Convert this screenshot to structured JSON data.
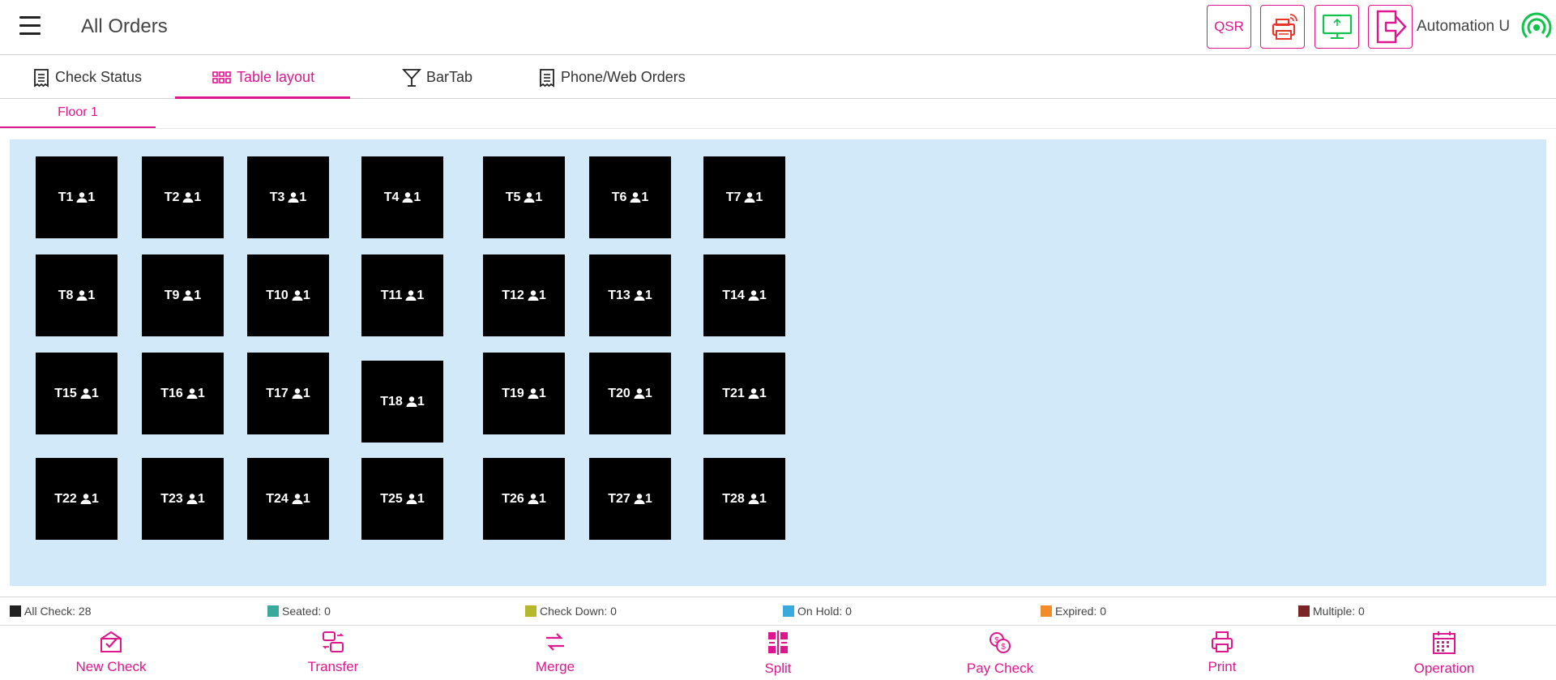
{
  "header": {
    "title": "All Orders",
    "qsr_label": "QSR",
    "user_name": "Automation U",
    "menu_icon": "hamburger-icon",
    "printer_icon": "wireless-printer-icon",
    "monitor_icon": "monitor-sync-icon",
    "logout_icon": "logout-icon",
    "signal_icon": "online-signal-icon"
  },
  "tabs": [
    {
      "label": "Check Status",
      "icon": "receipt-icon"
    },
    {
      "label": "Table layout",
      "icon": "grid-icon",
      "active": true
    },
    {
      "label": "BarTab",
      "icon": "cocktail-icon"
    },
    {
      "label": "Phone/Web Orders",
      "icon": "receipt-icon"
    }
  ],
  "floors": [
    {
      "label": "Floor 1",
      "active": true
    }
  ],
  "tables": [
    {
      "name": "T1",
      "guests": "1"
    },
    {
      "name": "T2",
      "guests": "1"
    },
    {
      "name": "T3",
      "guests": "1"
    },
    {
      "name": "T4",
      "guests": "1"
    },
    {
      "name": "T5",
      "guests": "1"
    },
    {
      "name": "T6",
      "guests": "1"
    },
    {
      "name": "T7",
      "guests": "1"
    },
    {
      "name": "T8",
      "guests": "1"
    },
    {
      "name": "T9",
      "guests": "1"
    },
    {
      "name": "T10",
      "guests": "1"
    },
    {
      "name": "T11",
      "guests": "1"
    },
    {
      "name": "T12",
      "guests": "1"
    },
    {
      "name": "T13",
      "guests": "1"
    },
    {
      "name": "T14",
      "guests": "1"
    },
    {
      "name": "T15",
      "guests": "1"
    },
    {
      "name": "T16",
      "guests": "1"
    },
    {
      "name": "T17",
      "guests": "1"
    },
    {
      "name": "T18",
      "guests": "1"
    },
    {
      "name": "T19",
      "guests": "1"
    },
    {
      "name": "T20",
      "guests": "1"
    },
    {
      "name": "T21",
      "guests": "1"
    },
    {
      "name": "T22",
      "guests": "1"
    },
    {
      "name": "T23",
      "guests": "1"
    },
    {
      "name": "T24",
      "guests": "1"
    },
    {
      "name": "T25",
      "guests": "1"
    },
    {
      "name": "T26",
      "guests": "1"
    },
    {
      "name": "T27",
      "guests": "1"
    },
    {
      "name": "T28",
      "guests": "1"
    }
  ],
  "legend": [
    {
      "label": "All Check: 28",
      "color": "#222222"
    },
    {
      "label": "Seated: 0",
      "color": "#3aa89b"
    },
    {
      "label": "Check Down: 0",
      "color": "#b5b82a"
    },
    {
      "label": "On Hold: 0",
      "color": "#3aa9de"
    },
    {
      "label": "Expired: 0",
      "color": "#f08c2a"
    },
    {
      "label": "Multiple: 0",
      "color": "#7a2424"
    }
  ],
  "actions": [
    {
      "label": "New Check",
      "icon": "new-check-icon"
    },
    {
      "label": "Transfer",
      "icon": "transfer-icon"
    },
    {
      "label": "Merge",
      "icon": "merge-icon"
    },
    {
      "label": "Split",
      "icon": "split-icon"
    },
    {
      "label": "Pay Check",
      "icon": "pay-check-icon"
    },
    {
      "label": "Print",
      "icon": "print-icon"
    },
    {
      "label": "Operation",
      "icon": "calendar-icon"
    }
  ],
  "colors": {
    "accent": "#e0168f",
    "floor_bg": "#d1e9f9",
    "table_bg": "#000000",
    "printer": "#e8342a",
    "monitor": "#10c34a",
    "signal": "#10c34a"
  }
}
